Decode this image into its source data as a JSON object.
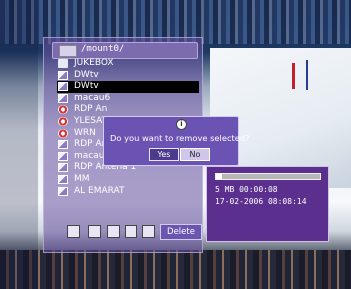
{
  "path": {
    "text": "/mount0/"
  },
  "files": [
    {
      "label": "JUKEBOX",
      "icon": "folder-icon"
    },
    {
      "label": "DWtv",
      "icon": "movie-file-icon"
    },
    {
      "label": "DWtv",
      "icon": "movie-file-icon",
      "selected": true
    },
    {
      "label": "macau6",
      "icon": "movie-file-icon"
    },
    {
      "label": "RDP An",
      "icon": "disc-file-icon"
    },
    {
      "label": "YLESAT",
      "icon": "disc-file-icon"
    },
    {
      "label": "WRN",
      "icon": "disc-file-icon"
    },
    {
      "label": "RDP An",
      "icon": "movie-file-icon"
    },
    {
      "label": "macau4",
      "icon": "movie-file-icon"
    },
    {
      "label": "RDP Antena 1",
      "icon": "movie-file-icon"
    },
    {
      "label": "MM",
      "icon": "movie-file-icon"
    },
    {
      "label": "AL EMARAT",
      "icon": "movie-file-icon"
    }
  ],
  "toolbar": {
    "delete_label": "Delete"
  },
  "dialog": {
    "info_glyph": "i",
    "message": "Do you want to remove selected?",
    "yes_label": "Yes",
    "no_label": "No"
  },
  "info_panel": {
    "progress_percent": 6,
    "size_time": "5 MB  00:00:08",
    "datetime": "17-02-2006 08:08:14"
  },
  "colors": {
    "panel_purple": "#5a2f8e",
    "button_purple": "#6b55b0",
    "selection": "#000000"
  }
}
